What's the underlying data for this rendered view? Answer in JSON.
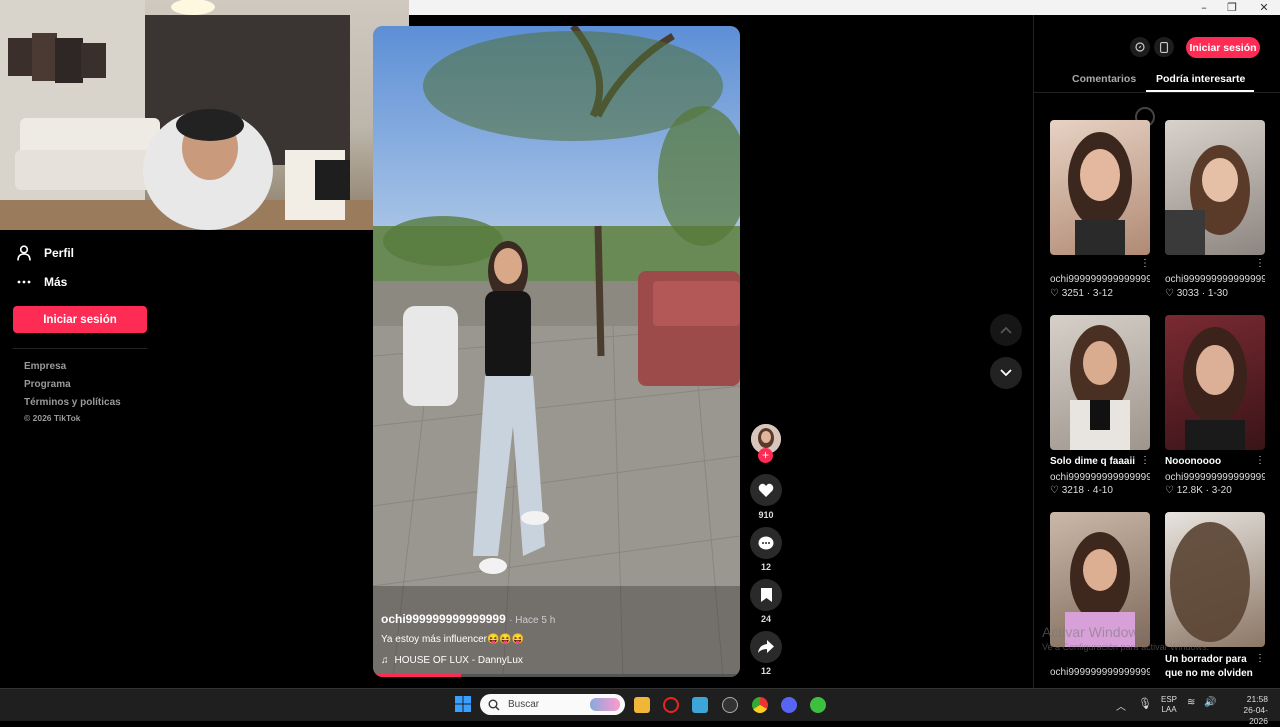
{
  "sidebar": {
    "items": [
      {
        "label": "Perfil",
        "icon": "person-icon"
      },
      {
        "label": "Más",
        "icon": "more-dots-icon"
      }
    ],
    "login_button": "Iniciar sesión",
    "footer": [
      "Empresa",
      "Programa",
      "Términos y políticas",
      "© 2026 TikTok"
    ]
  },
  "video": {
    "author": "ochi999999999999999",
    "time": "· Hace 5 h",
    "caption": "Ya estoy más influencer😝😝😝",
    "music": "HOUSE OF LUX - DannyLux",
    "progress": 0.24
  },
  "actions": {
    "likes": "910",
    "comments": "12",
    "saves": "24",
    "shares": "12"
  },
  "header": {
    "login_button": "Iniciar sesión"
  },
  "tabs": [
    {
      "label": "Comentarios",
      "active": false
    },
    {
      "label": "Podría interesarte",
      "active": true
    }
  ],
  "suggestions": [
    {
      "title": "",
      "author": "ochi999999999999999...",
      "likes": "3251",
      "date": "3-12"
    },
    {
      "title": "",
      "author": "ochi999999999999999...",
      "likes": "3033",
      "date": "1-30"
    },
    {
      "title": "Solo dime q faaaii",
      "author": "ochi999999999999999...",
      "likes": "3218",
      "date": "4-10"
    },
    {
      "title": "Nooonoooo",
      "author": "ochi999999999999999...",
      "likes": "12.8K",
      "date": "3-20"
    },
    {
      "title": "",
      "author": "ochi999999999999999...",
      "likes": "",
      "date": ""
    },
    {
      "title": "Un borrador para que no me olviden",
      "author": "",
      "likes": "",
      "date": ""
    }
  ],
  "watermark": {
    "line1": "Activar Windows",
    "line2": "Ve a Configuración para activar Windows."
  },
  "taskbar": {
    "search_placeholder": "Buscar",
    "lang1": "ESP",
    "lang2": "LAA",
    "time": "21:58",
    "date": "26-04-2026"
  },
  "colors": {
    "accent": "#fe2c55"
  }
}
